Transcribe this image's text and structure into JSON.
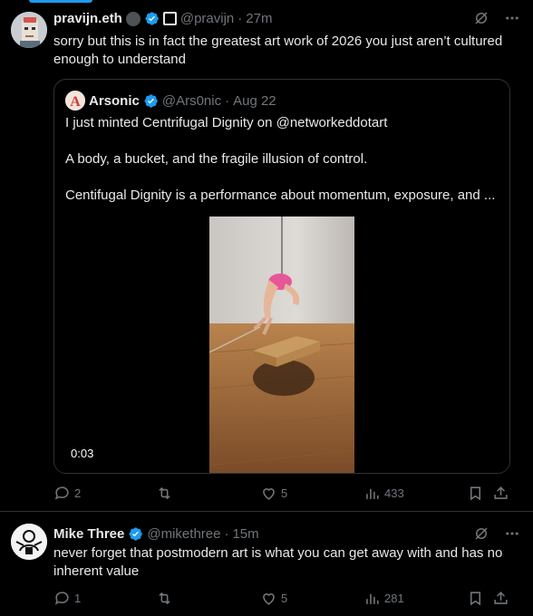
{
  "tweets": [
    {
      "name": "pravijn.eth",
      "handle": "@pravijn",
      "dot": "·",
      "time": "27m",
      "text": "sorry but this is in fact the greatest art work of 2026 you just aren’t cultured enough to understand",
      "quote": {
        "name": "Arsonic",
        "handle": "@Ars0nic",
        "dot": "·",
        "time": "Aug 22",
        "lines": [
          "I just minted Centrifugal Dignity on @networkeddotart",
          "A body, a bucket, and the fragile illusion of control.",
          "Centifugal Dignity is a performance about momentum, exposure, and ..."
        ],
        "video_duration": "0:03"
      },
      "replies": "2",
      "retweets": "",
      "likes": "5",
      "views": "433"
    },
    {
      "name": "Mike Three",
      "handle": "@mikethree",
      "dot": "·",
      "time": "15m",
      "text": "never forget that postmodern art is what you can get away with and has no inherent value",
      "replies": "1",
      "retweets": "",
      "likes": "5",
      "views": "281"
    }
  ],
  "colors": {
    "accent": "#1d9bf0",
    "muted": "#71767b",
    "text": "#e7e9ea",
    "border": "#2f3336"
  }
}
